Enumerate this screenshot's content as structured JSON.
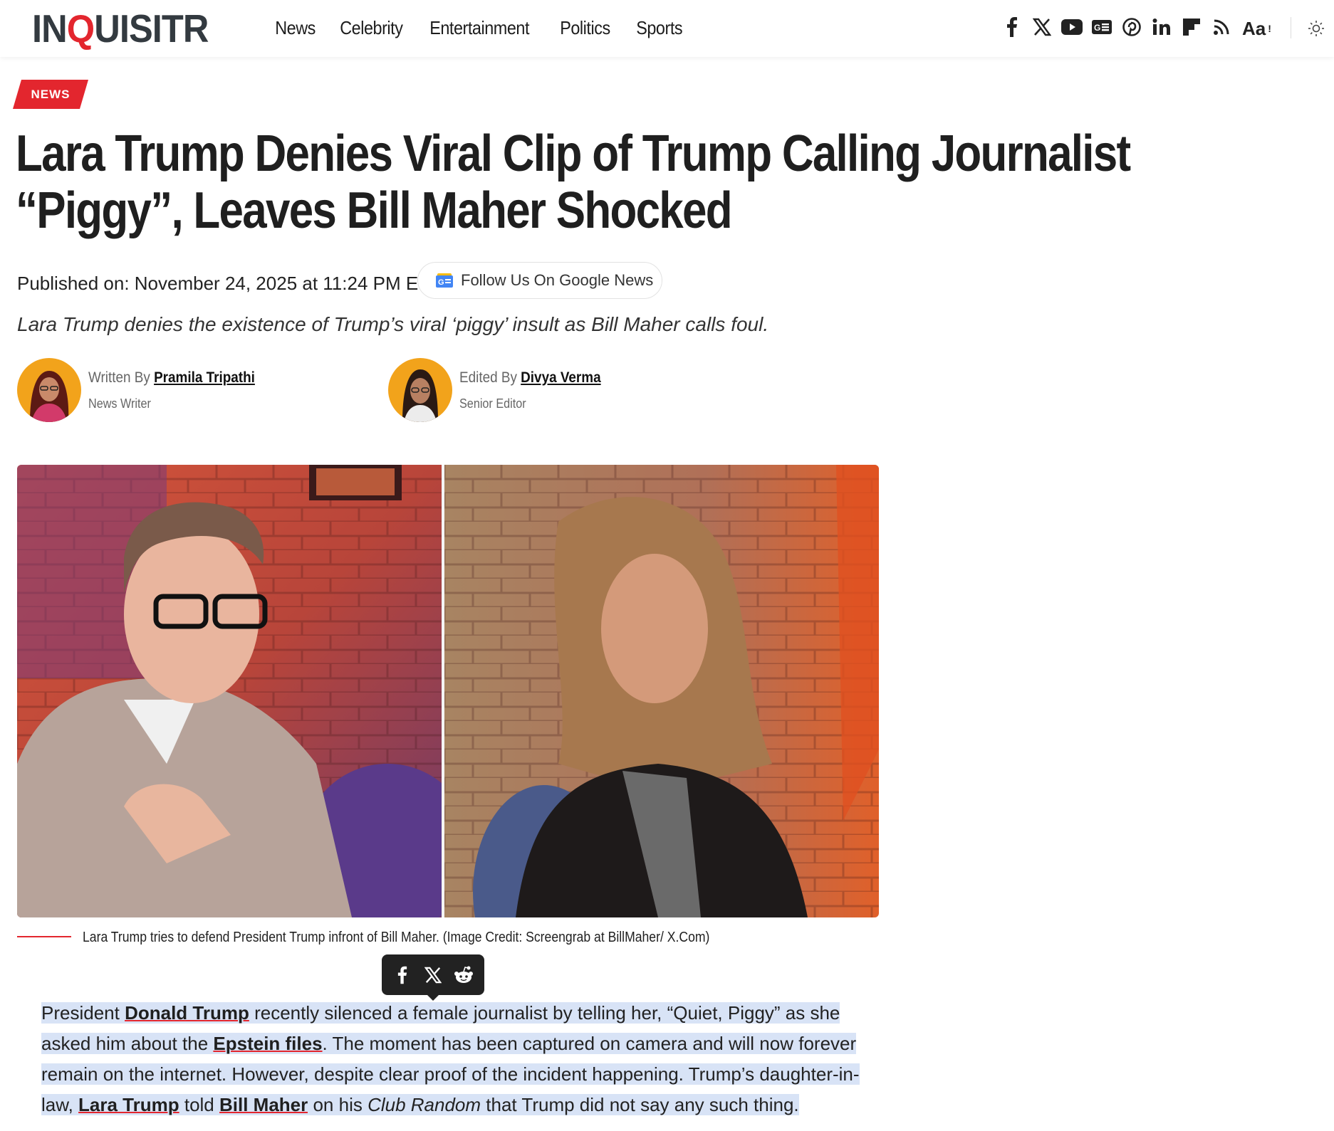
{
  "header": {
    "logo": "INQUISITR",
    "nav": [
      "News",
      "Celebrity",
      "Entertainment",
      "Politics",
      "Sports"
    ],
    "social_icons": [
      "facebook-icon",
      "x-icon",
      "youtube-icon",
      "google-news-icon",
      "pinterest-icon",
      "linkedin-icon",
      "flipboard-icon",
      "rss-icon"
    ],
    "font_size_label": "Aa",
    "font_size_indicator": "!",
    "theme_icon": "sun-icon"
  },
  "article": {
    "category": "NEWS",
    "title": "Lara Trump Denies Viral Clip of Trump Calling Journalist “Piggy”, Leaves Bill Maher Shocked",
    "published": "Published on: November 24, 2025 at 11:24 PM ET",
    "follow_label": "Follow Us On Google News",
    "subtitle": "Lara Trump denies the existence of Trump’s viral ‘piggy’ insult as Bill Maher calls foul.",
    "writer": {
      "prefix": "Written By",
      "name": "Pramila Tripathi",
      "role": "News Writer"
    },
    "editor": {
      "prefix": "Edited By",
      "name": "Divya Verma",
      "role": "Senior Editor"
    },
    "image_caption": "Lara Trump tries to defend President Trump infront of Bill Maher. (Image Credit: Screengrab at BillMaher/ X.Com)",
    "share_icons": [
      "facebook-icon",
      "x-icon",
      "reddit-icon"
    ],
    "body": {
      "p1_a": "President ",
      "link1": "Donald Trump",
      "p1_b": " recently silenced a female journalist by telling her, “Quiet, Piggy” as she asked him about the ",
      "link2": "Epstein files",
      "p1_c": ". The moment has been captured on camera and will now forever remain on the internet. However, despite clear proof of the incident happening. Trump’s daughter-in-law, ",
      "link3": "Lara Trump",
      "p1_d": " told ",
      "link4": "Bill Maher",
      "p1_e": " on his ",
      "em1": "Club Random",
      "p1_f": " that Trump did not say any such thing."
    }
  },
  "colors": {
    "accent": "#e3262e",
    "text": "#1f1f1f",
    "selection": "#d8e3f6"
  }
}
